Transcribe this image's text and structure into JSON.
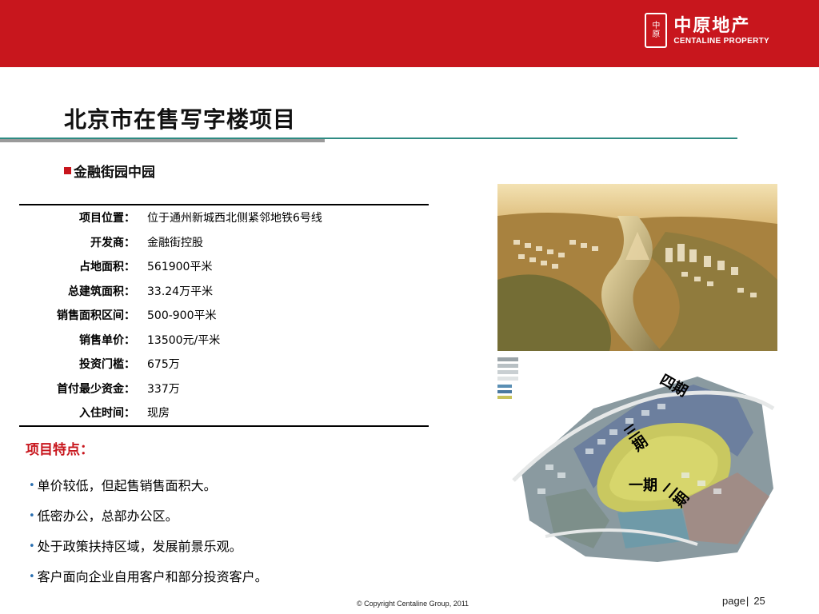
{
  "header": {
    "logo_seal_top": "中",
    "logo_seal_bottom": "原",
    "logo_cn": "中原地产",
    "logo_en": "CENTALINE PROPERTY"
  },
  "page_title": "北京市在售写字楼项目",
  "project_name": "金融街园中园",
  "details": [
    {
      "label": "项目位置：",
      "value": "位于通州新城西北侧紧邻地铁6号线"
    },
    {
      "label": "开发商：",
      "value": "金融街控股"
    },
    {
      "label": "占地面积：",
      "value": "561900平米"
    },
    {
      "label": "总建筑面积：",
      "value": "33.24万平米"
    },
    {
      "label": "销售面积区间：",
      "value": "500-900平米"
    },
    {
      "label": "销售单价：",
      "value": "13500元/平米"
    },
    {
      "label": "投资门槛：",
      "value": "675万"
    },
    {
      "label": "首付最少资金：",
      "value": "337万"
    },
    {
      "label": "入住时间：",
      "value": "现房"
    }
  ],
  "features": {
    "title": "项目特点：",
    "items": [
      "单价较低，但起售销售面积大。",
      "低密办公，总部办公区。",
      "处于政策扶持区域，发展前景乐观。",
      "客户面向企业自用客户和部分投资客户。"
    ]
  },
  "sitemap": {
    "phases": [
      "四期",
      "三期",
      "一期",
      "二期"
    ]
  },
  "footer": {
    "copyright": "© Copyright  Centaline Group, 2011",
    "page_label": "page",
    "page_separator": "|",
    "page_number": "25"
  },
  "colors": {
    "brand_red": "#c8161d",
    "teal_rule": "#2e8b83",
    "feature_bullet": "#2a6fb0"
  }
}
